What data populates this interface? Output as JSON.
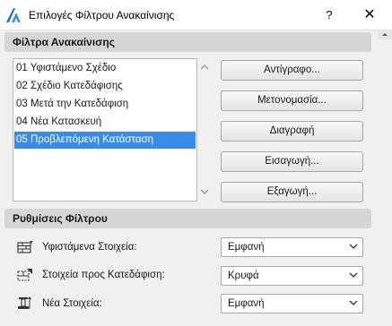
{
  "window": {
    "title": "Επιλογές Φίλτρου Ανακαίνισης",
    "help_label": "?",
    "close_label": "✕"
  },
  "filters_section": {
    "title": "Φίλτρα Ανακαίνισης",
    "items": [
      {
        "label": "01 Υφιστάμενο Σχέδιο",
        "selected": false
      },
      {
        "label": "02 Σχέδιο Κατεδάφισης",
        "selected": false
      },
      {
        "label": "03 Μετά την Κατεδάφιση",
        "selected": false
      },
      {
        "label": "04 Νέα Κατασκευή",
        "selected": false
      },
      {
        "label": "05 Προβλεπόμενη Κατάσταση",
        "selected": true
      }
    ],
    "buttons": {
      "copy": "Αντίγραφο...",
      "rename": "Μετονομασία...",
      "delete": "Διαγραφή",
      "import": "Εισαγωγή...",
      "export": "Εξαγωγή..."
    }
  },
  "settings_section": {
    "title": "Ρυθμίσεις Φίλτρου",
    "rows": [
      {
        "label": "Υφιστάμενα Στοιχεία:",
        "value": "Εμφανή",
        "icon": "existing-elements-icon"
      },
      {
        "label": "Στοιχεία προς Κατεδάφιση:",
        "value": "Κρυφά",
        "icon": "demolish-elements-icon"
      },
      {
        "label": "Νέα Στοιχεία:",
        "value": "Εμφανή",
        "icon": "new-elements-icon"
      }
    ]
  },
  "colors": {
    "selection": "#3a8be8",
    "section_header": "#d6d6d6",
    "app_icon": "#1f6fc6"
  }
}
